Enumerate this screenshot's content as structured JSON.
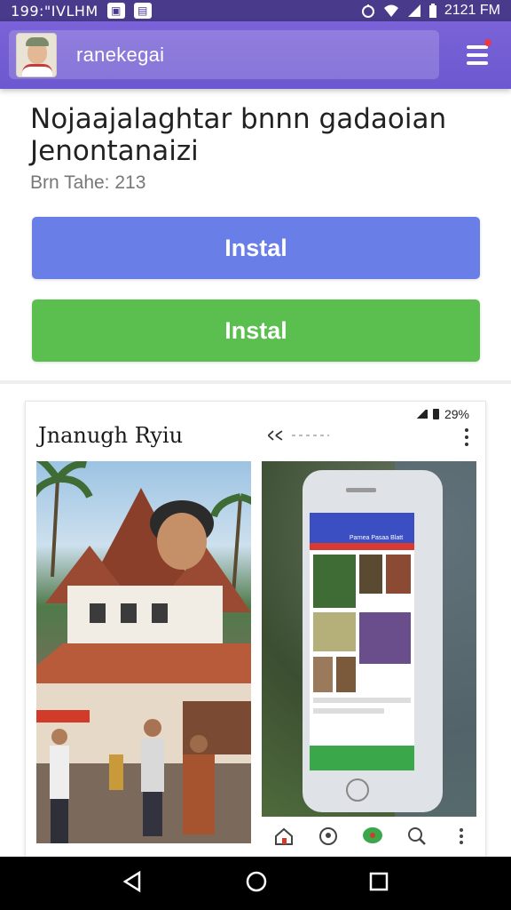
{
  "status_bar": {
    "time": "199:\"IVLHM",
    "clock": "2121 FM"
  },
  "app_bar": {
    "search_text": "ranekegai"
  },
  "listing": {
    "title": "Nojaajalaghtar bnnn gadaoian Jenontanaizi",
    "subtitle": "Brn Tahe: 213",
    "buttons": [
      {
        "label": "Instal",
        "color": "#6a7ee8"
      },
      {
        "label": "Instal",
        "color": "#5bbf4f"
      }
    ]
  },
  "card": {
    "status_text": "29%",
    "title": "Jnanugh Ryiu",
    "phone_header": "Parnea Pasaa Blatt"
  },
  "colors": {
    "app_bar": "#7a63d8",
    "accent_blue": "#6a7ee8",
    "accent_green": "#5bbf4f"
  }
}
